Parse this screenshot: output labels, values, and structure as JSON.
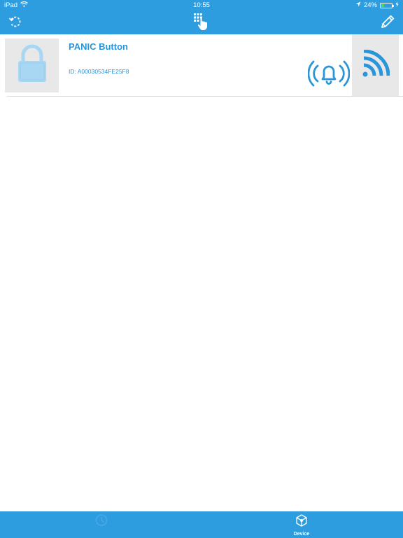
{
  "status_bar": {
    "device": "iPad",
    "wifi_icon": "wifi-icon",
    "time": "10:55",
    "location_icon": "location-arrow-icon",
    "battery_percent": "24%",
    "battery_level": 0.24,
    "charging_icon": "charging-bolt-icon"
  },
  "nav_bar": {
    "left_icon": "refresh-icon",
    "center_icon": "keypad-touch-icon",
    "right_icon": "pencil-icon"
  },
  "devices": [
    {
      "name": "PANIC Button",
      "id": "ID: A00030534FE25F8",
      "thumb_icon": "padlock-icon",
      "status_icon": "alarm-bell-icon",
      "signal_icon": "signal-icon"
    }
  ],
  "tab_bar": {
    "tabs": [
      {
        "label": "",
        "icon": "history-icon",
        "active": false
      },
      {
        "label": "Device",
        "icon": "device-icon",
        "active": true
      }
    ]
  },
  "colors": {
    "accent": "#2d9de0",
    "text_blue": "#2a95d8",
    "thumb_bg": "#e8e8e8"
  }
}
